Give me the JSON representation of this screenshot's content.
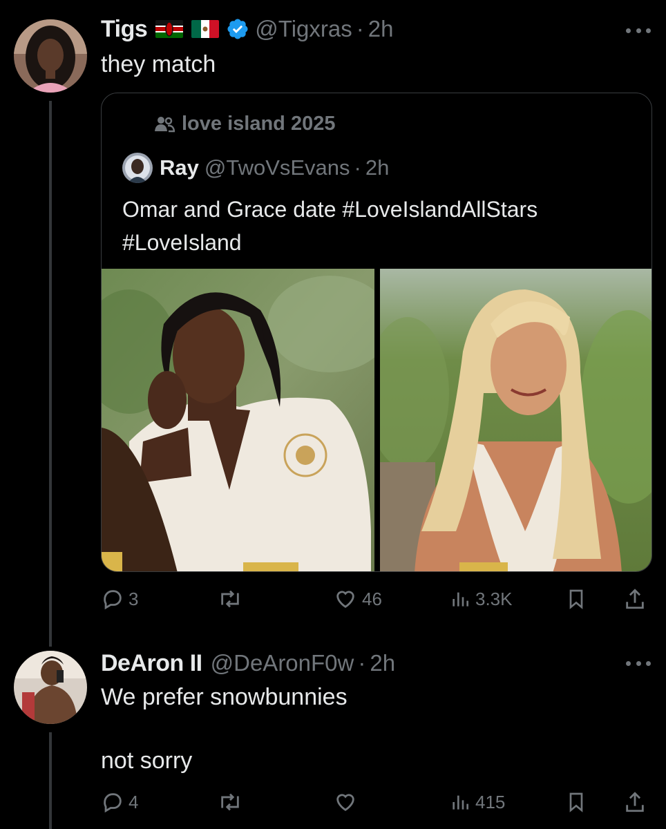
{
  "tweets": [
    {
      "name": "Tigs",
      "handle": "@Tigxras",
      "time": "2h",
      "text": "they match",
      "quote": {
        "community": "love island 2025",
        "name": "Ray",
        "handle": "@TwoVsEvans",
        "time": "2h",
        "text": "Omar and Grace date #LoveIslandAllStars #LoveIsland"
      },
      "stats": {
        "replies": "3",
        "reposts": "",
        "likes": "46",
        "views": "3.3K"
      }
    },
    {
      "name": "DeAron II",
      "handle": "@DeAronF0w",
      "time": "2h",
      "text": "We prefer snowbunnies\n\nnot sorry",
      "stats": {
        "replies": "4",
        "reposts": "",
        "likes": "",
        "views": "415"
      }
    }
  ],
  "icons": {
    "reply": "reply-icon",
    "repost": "repost-icon",
    "like": "heart-icon",
    "views": "views-icon",
    "bookmark": "bookmark-icon",
    "share": "share-icon"
  },
  "colors": {
    "background": "#000000",
    "text": "#e7e9ea",
    "muted": "#71767b",
    "verified": "#1d9bf0"
  }
}
